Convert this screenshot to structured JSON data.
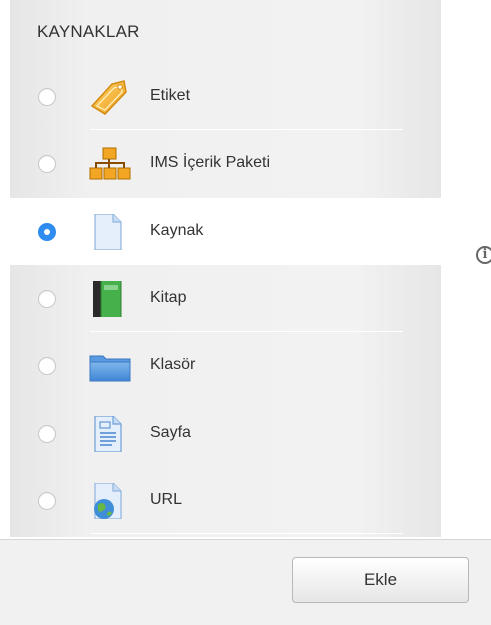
{
  "header": {
    "title": "KAYNAKLAR"
  },
  "items": [
    {
      "label": "Etiket",
      "icon": "tag-icon",
      "selected": false
    },
    {
      "label": "IMS İçerik Paketi",
      "icon": "ims-package-icon",
      "selected": false
    },
    {
      "label": "Kaynak",
      "icon": "file-icon",
      "selected": true
    },
    {
      "label": "Kitap",
      "icon": "book-icon",
      "selected": false
    },
    {
      "label": "Klasör",
      "icon": "folder-icon",
      "selected": false
    },
    {
      "label": "Sayfa",
      "icon": "page-icon",
      "selected": false
    },
    {
      "label": "URL",
      "icon": "url-globe-icon",
      "selected": false
    }
  ],
  "info_icon": "i",
  "footer": {
    "add_label": "Ekle"
  },
  "colors": {
    "accent": "#2f8cf0",
    "panel": "#f2f2f2"
  }
}
